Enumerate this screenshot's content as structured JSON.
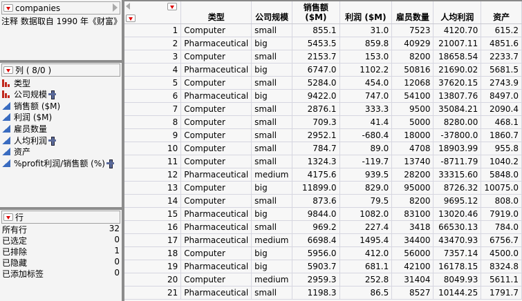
{
  "table_panel": {
    "title": "companies",
    "note": "注释 数据取自 1990 年《财富》"
  },
  "columns_panel": {
    "title": "列 ( 8/0 )",
    "items": [
      {
        "label": "类型",
        "type": "nominal",
        "has_plus": false
      },
      {
        "label": "公司规模",
        "type": "nominal",
        "has_plus": true
      },
      {
        "label": "销售额 ($M)",
        "type": "continuous",
        "has_plus": false
      },
      {
        "label": "利润 ($M)",
        "type": "continuous",
        "has_plus": false
      },
      {
        "label": "雇员数量",
        "type": "continuous",
        "has_plus": false
      },
      {
        "label": "人均利润",
        "type": "continuous",
        "has_plus": true
      },
      {
        "label": "资产",
        "type": "continuous",
        "has_plus": false
      },
      {
        "label": "%profit利润/销售额 (%)",
        "type": "continuous",
        "has_plus": true
      }
    ]
  },
  "rows_panel": {
    "title": "行",
    "items": [
      {
        "label": "所有行",
        "value": "32"
      },
      {
        "label": "已选定",
        "value": "0"
      },
      {
        "label": "已排除",
        "value": "1"
      },
      {
        "label": "已隐藏",
        "value": "0"
      },
      {
        "label": "已添加标签",
        "value": "0"
      }
    ]
  },
  "grid": {
    "headers": [
      "类型",
      "公司规模",
      "销售额\n($M)",
      "利润 ($M)",
      "雇员数量",
      "人均利润",
      "资产"
    ],
    "rows": [
      [
        "1",
        "Computer",
        "small",
        "855.1",
        "31.0",
        "7523",
        "4120.70",
        "615.2"
      ],
      [
        "2",
        "Pharmaceutical",
        "big",
        "5453.5",
        "859.8",
        "40929",
        "21007.11",
        "4851.6"
      ],
      [
        "3",
        "Computer",
        "small",
        "2153.7",
        "153.0",
        "8200",
        "18658.54",
        "2233.7"
      ],
      [
        "4",
        "Pharmaceutical",
        "big",
        "6747.0",
        "1102.2",
        "50816",
        "21690.02",
        "5681.5"
      ],
      [
        "5",
        "Computer",
        "small",
        "5284.0",
        "454.0",
        "12068",
        "37620.15",
        "2743.9"
      ],
      [
        "6",
        "Pharmaceutical",
        "big",
        "9422.0",
        "747.0",
        "54100",
        "13807.76",
        "8497.0"
      ],
      [
        "7",
        "Computer",
        "small",
        "2876.1",
        "333.3",
        "9500",
        "35084.21",
        "2090.4"
      ],
      [
        "8",
        "Computer",
        "small",
        "709.3",
        "41.4",
        "5000",
        "8280.00",
        "468.1"
      ],
      [
        "9",
        "Computer",
        "small",
        "2952.1",
        "-680.4",
        "18000",
        "-37800.0",
        "1860.7"
      ],
      [
        "10",
        "Computer",
        "small",
        "784.7",
        "89.0",
        "4708",
        "18903.99",
        "955.8"
      ],
      [
        "11",
        "Computer",
        "small",
        "1324.3",
        "-119.7",
        "13740",
        "-8711.79",
        "1040.2"
      ],
      [
        "12",
        "Pharmaceutical",
        "medium",
        "4175.6",
        "939.5",
        "28200",
        "33315.60",
        "5848.0"
      ],
      [
        "13",
        "Computer",
        "big",
        "11899.0",
        "829.0",
        "95000",
        "8726.32",
        "10075.0"
      ],
      [
        "14",
        "Computer",
        "small",
        "873.6",
        "79.5",
        "8200",
        "9695.12",
        "808.0"
      ],
      [
        "15",
        "Pharmaceutical",
        "big",
        "9844.0",
        "1082.0",
        "83100",
        "13020.46",
        "7919.0"
      ],
      [
        "16",
        "Pharmaceutical",
        "small",
        "969.2",
        "227.4",
        "3418",
        "66530.13",
        "784.0"
      ],
      [
        "17",
        "Pharmaceutical",
        "medium",
        "6698.4",
        "1495.4",
        "34400",
        "43470.93",
        "6756.7"
      ],
      [
        "18",
        "Computer",
        "big",
        "5956.0",
        "412.0",
        "56000",
        "7357.14",
        "4500.0"
      ],
      [
        "19",
        "Pharmaceutical",
        "big",
        "5903.7",
        "681.1",
        "42100",
        "16178.15",
        "8324.8"
      ],
      [
        "20",
        "Computer",
        "medium",
        "2959.3",
        "252.8",
        "31404",
        "8049.93",
        "5611.1"
      ],
      [
        "21",
        "Pharmaceutical",
        "small",
        "1198.3",
        "86.5",
        "8527",
        "10144.25",
        "1791.7"
      ]
    ]
  },
  "colors": {
    "menu_triangle": "#dd0000",
    "nominal_icon": "#c0281c",
    "continuous_icon": "#3a6cc0"
  }
}
